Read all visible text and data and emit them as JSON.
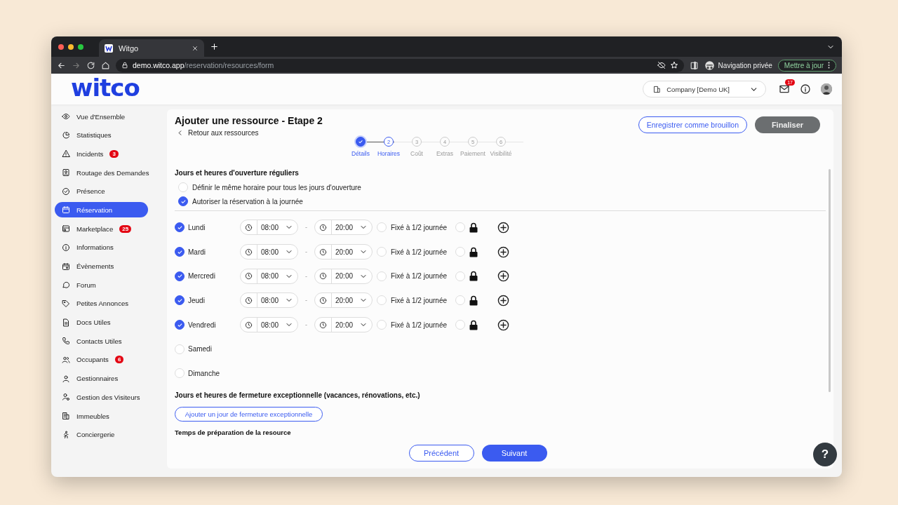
{
  "browser": {
    "tab_title": "Witgo",
    "url_host": "demo.witco.app",
    "url_path": "/reservation/resources/form",
    "private_label": "Navigation privée",
    "update_button": "Mettre à jour"
  },
  "header": {
    "logo": "witco",
    "company": "Company [Demo UK]",
    "mail_count": "17"
  },
  "sidebar": {
    "items": [
      {
        "label": "Vue d'Ensemble",
        "selected": false
      },
      {
        "label": "Statistiques",
        "selected": false
      },
      {
        "label": "Incidents",
        "selected": false,
        "badge": "3"
      },
      {
        "label": "Routage des Demandes",
        "selected": false
      },
      {
        "label": "Présence",
        "selected": false
      },
      {
        "label": "Réservation",
        "selected": true
      },
      {
        "label": "Marketplace",
        "selected": false,
        "badge": "25"
      },
      {
        "label": "Informations",
        "selected": false
      },
      {
        "label": "Évènements",
        "selected": false
      },
      {
        "label": "Forum",
        "selected": false
      },
      {
        "label": "Petites Annonces",
        "selected": false
      },
      {
        "label": "Docs Utiles",
        "selected": false
      },
      {
        "label": "Contacts Utiles",
        "selected": false
      },
      {
        "label": "Occupants",
        "selected": false,
        "badge": "6"
      },
      {
        "label": "Gestionnaires",
        "selected": false
      },
      {
        "label": "Gestion des Visiteurs",
        "selected": false
      },
      {
        "label": "Immeubles",
        "selected": false
      },
      {
        "label": "Conciergerie",
        "selected": false
      }
    ]
  },
  "form": {
    "title": "Ajouter une ressource - Etape 2",
    "back_link": "Retour aux ressources",
    "draft_button": "Enregistrer comme brouillon",
    "finalize_button": "Finaliser",
    "steps": [
      {
        "label": "Détails",
        "done": true,
        "selected": false
      },
      {
        "number": "2",
        "label": "Horaires",
        "done": false,
        "selected": true
      },
      {
        "number": "3",
        "label": "Coût",
        "done": false,
        "selected": false
      },
      {
        "number": "4",
        "label": "Extras",
        "done": false,
        "selected": false
      },
      {
        "number": "5",
        "label": "Paiement",
        "done": false,
        "selected": false
      },
      {
        "number": "6",
        "label": "Visibilité",
        "done": false,
        "selected": false
      }
    ],
    "opening_title": "Jours et heures d'ouverture réguliers",
    "options": [
      {
        "label": "Définir le même horaire pour tous les jours d'ouverture",
        "checked": false
      },
      {
        "label": "Autoriser la réservation à la journée",
        "checked": true
      }
    ],
    "days": [
      {
        "name": "Lundi",
        "checked": true,
        "from": "08:00",
        "to": "20:00",
        "half_day_label": "Fixé à 1/2 journée",
        "half_day": false,
        "locked": false
      },
      {
        "name": "Mardi",
        "checked": true,
        "from": "08:00",
        "to": "20:00",
        "half_day_label": "Fixé à 1/2 journée",
        "half_day": false,
        "locked": false
      },
      {
        "name": "Mercredi",
        "checked": true,
        "from": "08:00",
        "to": "20:00",
        "half_day_label": "Fixé à 1/2 journée",
        "half_day": false,
        "locked": false
      },
      {
        "name": "Jeudi",
        "checked": true,
        "from": "08:00",
        "to": "20:00",
        "half_day_label": "Fixé à 1/2 journée",
        "half_day": false,
        "locked": false
      },
      {
        "name": "Vendredi",
        "checked": true,
        "from": "08:00",
        "to": "20:00",
        "half_day_label": "Fixé à 1/2 journée",
        "half_day": false,
        "locked": false
      },
      {
        "name": "Samedi",
        "checked": false
      },
      {
        "name": "Dimanche",
        "checked": false
      }
    ],
    "time_separator": "-",
    "closure_title": "Jours et heures de fermeture exceptionnelle (vacances, rénovations, etc.)",
    "add_closure_button": "Ajouter un jour de fermeture exceptionnelle",
    "prep_title": "Temps de préparation de la resource",
    "prev_button": "Précédent",
    "next_button": "Suivant"
  },
  "help_button": "?"
}
